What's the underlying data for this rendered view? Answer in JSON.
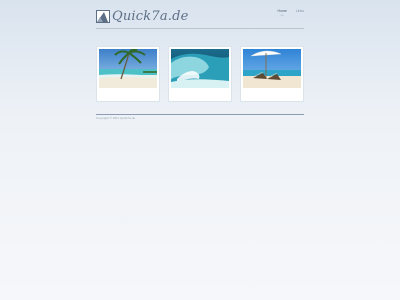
{
  "site": {
    "logo_text": "Quick7a.de"
  },
  "nav": {
    "items": [
      {
        "label": "Home",
        "sub": "ss",
        "active": true
      },
      {
        "label": "Links",
        "sub": "",
        "active": false
      }
    ]
  },
  "gallery": {
    "images": [
      {
        "subject": "palm tree beach"
      },
      {
        "subject": "ocean wave"
      },
      {
        "subject": "beach umbrella with loungers"
      }
    ]
  },
  "footer": {
    "copyright": "Copyright © 2011 Quick7a.de"
  },
  "colors": {
    "accent": "#5d6f86",
    "rule": "#8e9bb0"
  }
}
